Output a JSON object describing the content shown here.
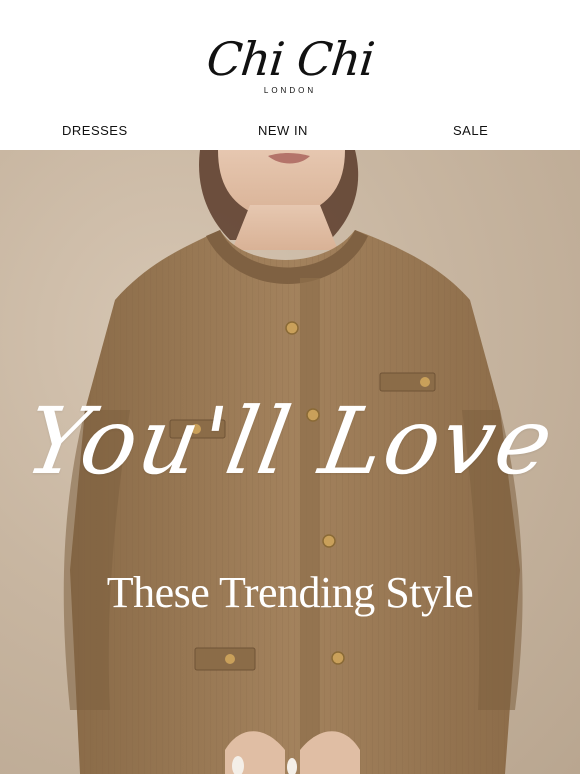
{
  "brand": {
    "name": "Chi Chi",
    "subtitle": "LONDON"
  },
  "nav": {
    "items": [
      {
        "label": "DRESSES"
      },
      {
        "label": "NEW IN"
      },
      {
        "label": "SALE"
      }
    ]
  },
  "hero": {
    "headline": "You'll Love",
    "subheadline": "These Trending Style",
    "colors": {
      "background": "#c8b6a1",
      "dress": "#9b7a55",
      "buttons": "#c9a05a",
      "text": "#ffffff"
    }
  }
}
